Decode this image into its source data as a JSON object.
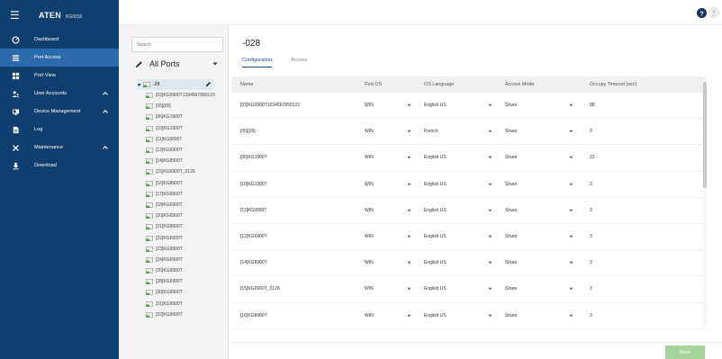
{
  "brand": {
    "logo": "ATEN",
    "model": "KG0032"
  },
  "sidebar": {
    "items": [
      {
        "label": "Dashboard",
        "icon": "dashboard-icon"
      },
      {
        "label": "Port Access",
        "icon": "list-icon",
        "active": true
      },
      {
        "label": "Port View",
        "icon": "grid-icon"
      },
      {
        "label": "User Accounts",
        "icon": "users-icon",
        "expandable": true
      },
      {
        "label": "Device Management",
        "icon": "device-icon",
        "expandable": true
      },
      {
        "label": "Log",
        "icon": "log-icon"
      },
      {
        "label": "Maintenance",
        "icon": "tools-icon",
        "expandable": true
      },
      {
        "label": "Download",
        "icon": "download-icon"
      }
    ]
  },
  "tree": {
    "search_placeholder": "Search",
    "all_ports_label": "All Ports",
    "root_label": "-28",
    "items": [
      "[03]KG9900T1234567890123",
      "[05][05]",
      "[06]KG1900T",
      "[10]KG1900T",
      "[11]KG9900T",
      "[12]KG6900T",
      "[14]KG8900T",
      "[15]KG6900T_0126",
      "[16]KG8900T",
      "[17]KG6900T",
      "[18]KG6900T",
      "[20]KG6900T",
      "[21]KG9900T",
      "[22]KG6900T",
      "[23]KG9900T",
      "[24]KG6900T",
      "[26]KG8900T",
      "[28]KG6900T",
      "[30]KG8900T",
      "[31]KG9900T",
      "[32]KG8900T"
    ]
  },
  "main": {
    "title": "-028",
    "tabs": [
      "Configuration",
      "Access"
    ],
    "active_tab": "Configuration",
    "columns": [
      "Name",
      "Port OS",
      "OS Language",
      "Access Mode",
      "Occupy Timeout (sec)"
    ],
    "rows": [
      {
        "name": "[03]KG9900T1234567890123",
        "os": "WIN",
        "lang": "English US",
        "mode": "Share",
        "timeout": "88"
      },
      {
        "name": "[05][05]",
        "os": "WIN",
        "lang": "French",
        "mode": "Share",
        "timeout": "3"
      },
      {
        "name": "[06]KG1900T",
        "os": "WIN",
        "lang": "English US",
        "mode": "Share",
        "timeout": "22"
      },
      {
        "name": "[10]KG1900T",
        "os": "WIN",
        "lang": "English US",
        "mode": "Share",
        "timeout": "3"
      },
      {
        "name": "[11]KG9900T",
        "os": "WIN",
        "lang": "English US",
        "mode": "Share",
        "timeout": "3"
      },
      {
        "name": "[12]KG6900T",
        "os": "WIN",
        "lang": "English US",
        "mode": "Share",
        "timeout": "3"
      },
      {
        "name": "[14]KG8900T",
        "os": "WIN",
        "lang": "English US",
        "mode": "Share",
        "timeout": "3"
      },
      {
        "name": "[15]KG6900T_0126",
        "os": "WIN",
        "lang": "English US",
        "mode": "Share",
        "timeout": "3"
      },
      {
        "name": "[16]KG8900T",
        "os": "WIN",
        "lang": "English US",
        "mode": "Share",
        "timeout": "3"
      }
    ],
    "save_label": "Save"
  },
  "colors": {
    "sidebar_bg": "#0f3f6f",
    "sidebar_active": "#2b6bab",
    "accent": "#1a4f85",
    "save_button": "#a7d49b",
    "node_icon_green": "#3aa635"
  }
}
